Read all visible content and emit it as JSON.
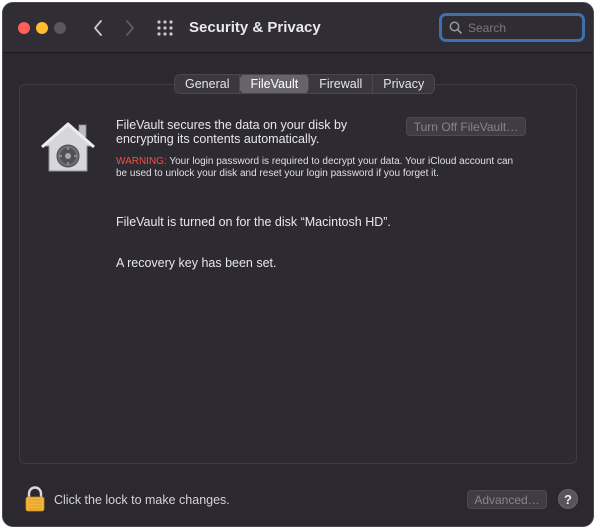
{
  "window": {
    "title": "Security & Privacy",
    "traffic_lights": {
      "close_color": "#ff5f57",
      "minimize_color": "#febc2e",
      "zoom_color": "#5a5760"
    }
  },
  "toolbar": {
    "back_icon": "chevron-left-icon",
    "forward_icon": "chevron-right-icon",
    "grid_icon": "grid-icon"
  },
  "search": {
    "placeholder": "Search",
    "value": ""
  },
  "tabs": [
    {
      "label": "General",
      "active": false
    },
    {
      "label": "FileVault",
      "active": true
    },
    {
      "label": "Firewall",
      "active": false
    },
    {
      "label": "Privacy",
      "active": false
    }
  ],
  "filevault": {
    "icon": "filevault-house-icon",
    "description": "FileVault secures the data on your disk by encrypting its contents automatically.",
    "turn_off_button": "Turn Off FileVault…",
    "warning_label": "WARNING:",
    "warning_text": " Your login password is required to decrypt your data. Your iCloud account can be used to unlock your disk and reset your login password if you forget it.",
    "status_disk": "FileVault is turned on for the disk “Macintosh HD”.",
    "status_recovery": "A recovery key has been set."
  },
  "footer": {
    "lock_text": "Click the lock to make changes.",
    "advanced_button": "Advanced…",
    "help_button": "?"
  },
  "colors": {
    "accent": "#3d70ad",
    "warning": "#ff4a40",
    "window_bg": "#2b2830"
  }
}
